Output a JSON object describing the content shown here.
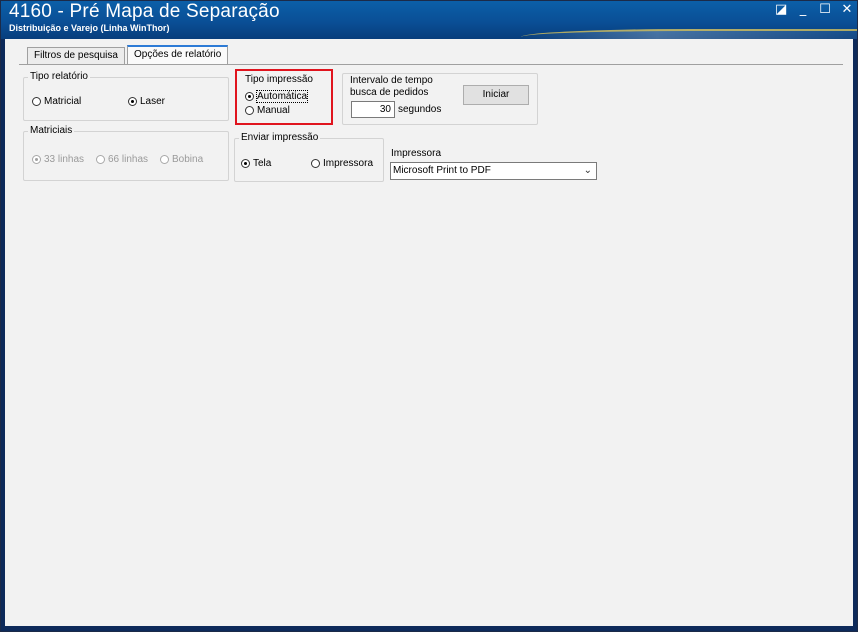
{
  "window": {
    "title": "4160 - Pré Mapa de Separação",
    "subtitle": "Distribuição e Varejo (Linha WinThor)",
    "controls": {
      "restore": "◪",
      "minimize": "_",
      "maximize": "☐",
      "close": "✕"
    }
  },
  "tabs": [
    {
      "label": "Filtros de pesquisa",
      "active": false
    },
    {
      "label": "Opções de relatório",
      "active": true
    }
  ],
  "tipo_relatorio": {
    "label": "Tipo relatório",
    "options": [
      {
        "label": "Matricial",
        "checked": false
      },
      {
        "label": "Laser",
        "checked": true
      }
    ]
  },
  "matriciais": {
    "label": "Matriciais",
    "options": [
      {
        "label": "33 linhas",
        "checked": true
      },
      {
        "label": "66 linhas",
        "checked": false
      },
      {
        "label": "Bobina",
        "checked": false
      }
    ]
  },
  "tipo_impressao": {
    "label": "Tipo impressão",
    "options": [
      {
        "label": "Automática",
        "checked": true
      },
      {
        "label": "Manual",
        "checked": false
      }
    ]
  },
  "intervalo": {
    "label_line1": "Intervalo de tempo",
    "label_line2": "busca de pedidos",
    "value": "30",
    "unit": "segundos",
    "button": "Iniciar"
  },
  "enviar_impressao": {
    "label": "Enviar impressão",
    "options": [
      {
        "label": "Tela",
        "checked": true
      },
      {
        "label": "Impressora",
        "checked": false
      }
    ]
  },
  "impressora": {
    "label": "Impressora",
    "selected": "Microsoft Print to PDF"
  },
  "colors": {
    "titlebar": "#0a4f96",
    "highlight": "#e0141e",
    "tab_accent": "#2d7bd6"
  }
}
